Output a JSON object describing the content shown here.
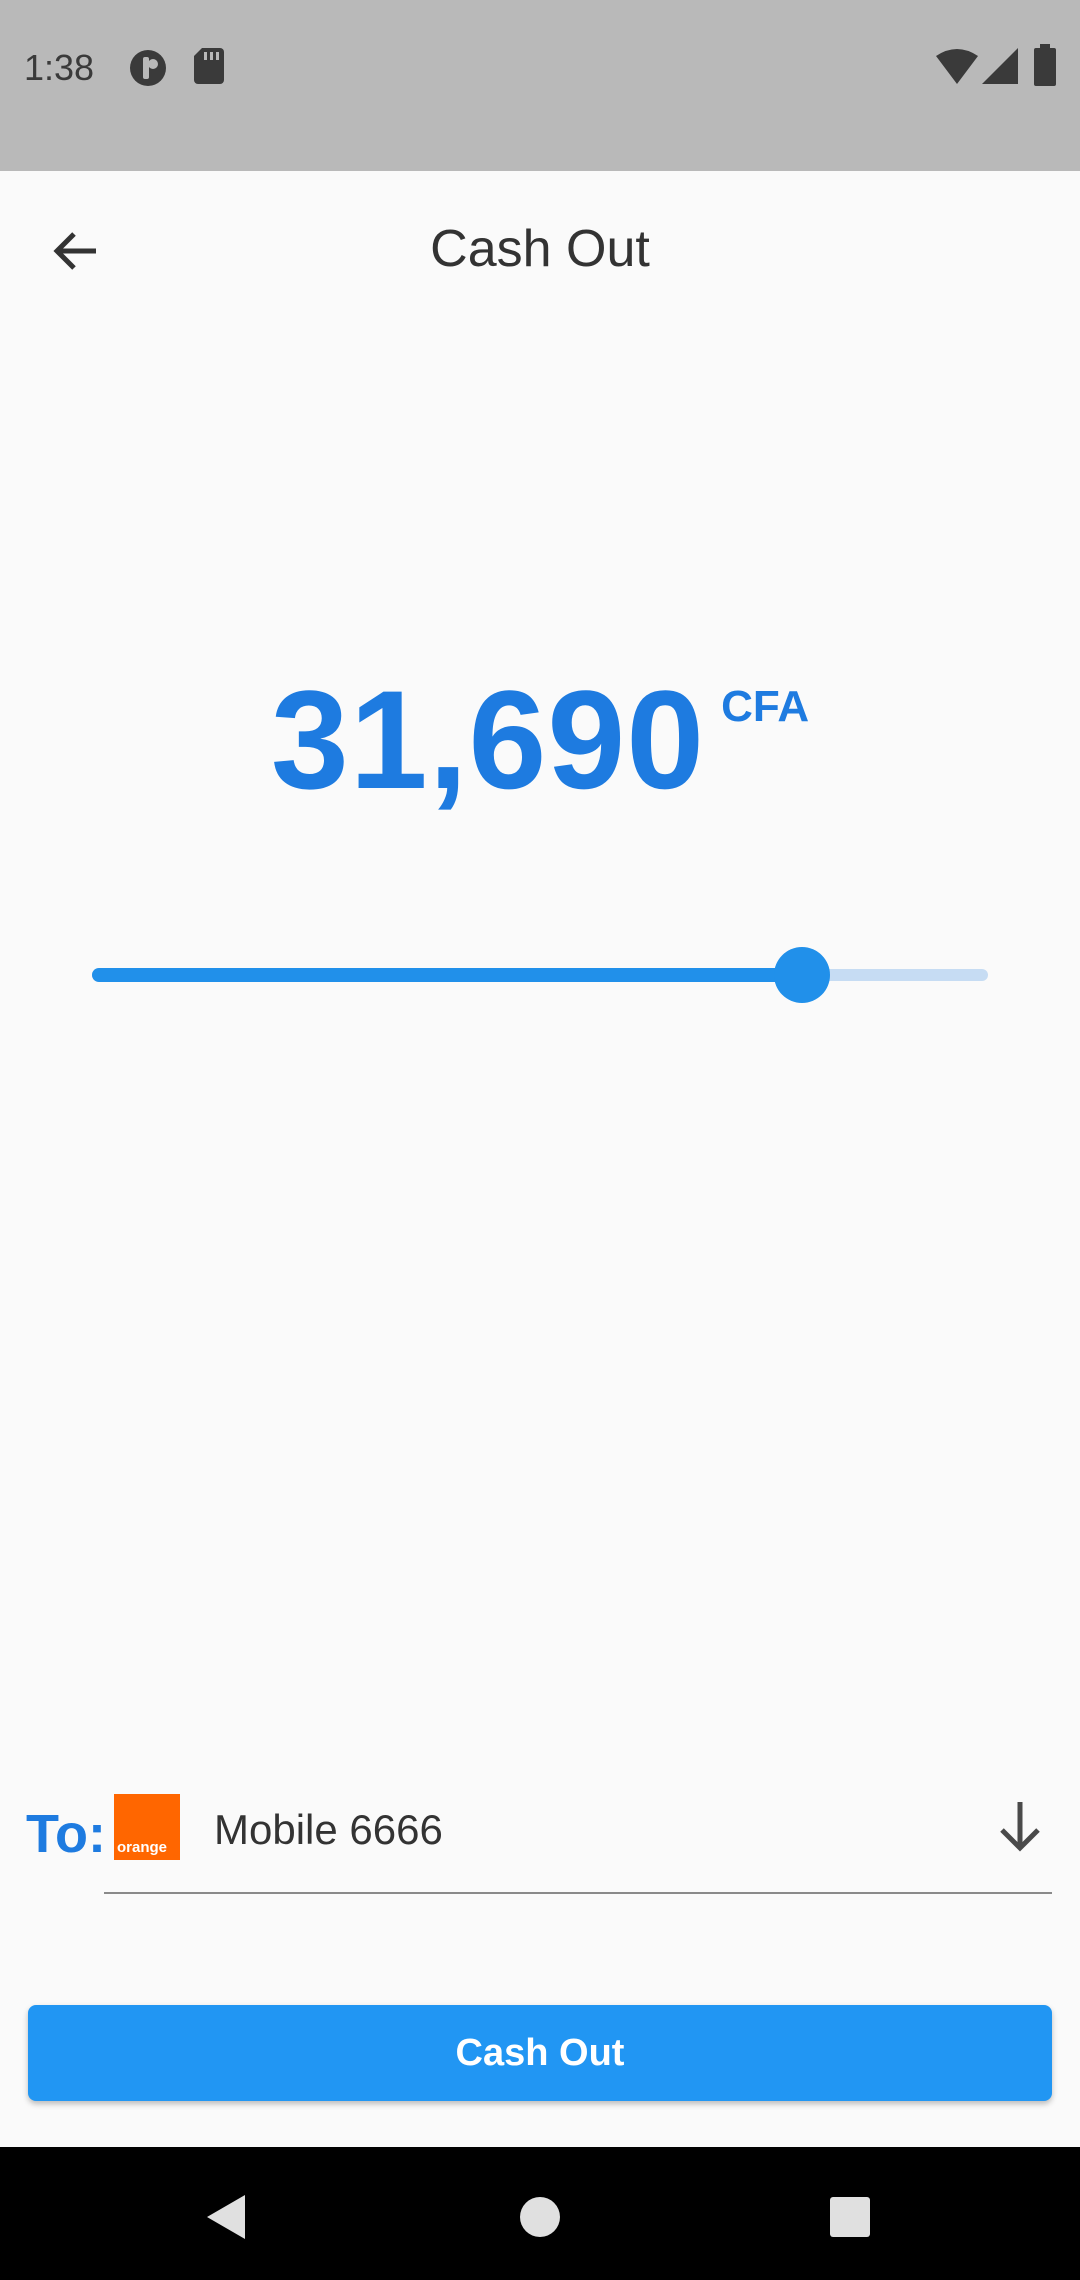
{
  "status_bar": {
    "time": "1:38",
    "icons": [
      "circle-badge-icon",
      "sd-card-icon",
      "wifi-icon",
      "signal-icon",
      "battery-icon"
    ]
  },
  "header": {
    "title": "Cash Out",
    "back_icon": "arrow-left-icon"
  },
  "amount": {
    "value": "31,690",
    "currency": "CFA",
    "slider_fraction": 0.792
  },
  "recipient": {
    "label": "To:",
    "operator_logo_text": "orange",
    "account": "Mobile 6666",
    "dropdown_icon": "arrow-down-icon"
  },
  "action": {
    "button_label": "Cash Out"
  },
  "nav_bar": {
    "icons": [
      "back-triangle-icon",
      "home-circle-icon",
      "recents-square-icon"
    ]
  },
  "colors": {
    "accent": "#1e7be0",
    "button": "#2196f3",
    "slider_active": "#2190ea",
    "slider_inactive": "#c6dcf3",
    "operator_brand": "#ff6600",
    "status_bar": "#b9b9b9",
    "background": "#fafafa"
  }
}
